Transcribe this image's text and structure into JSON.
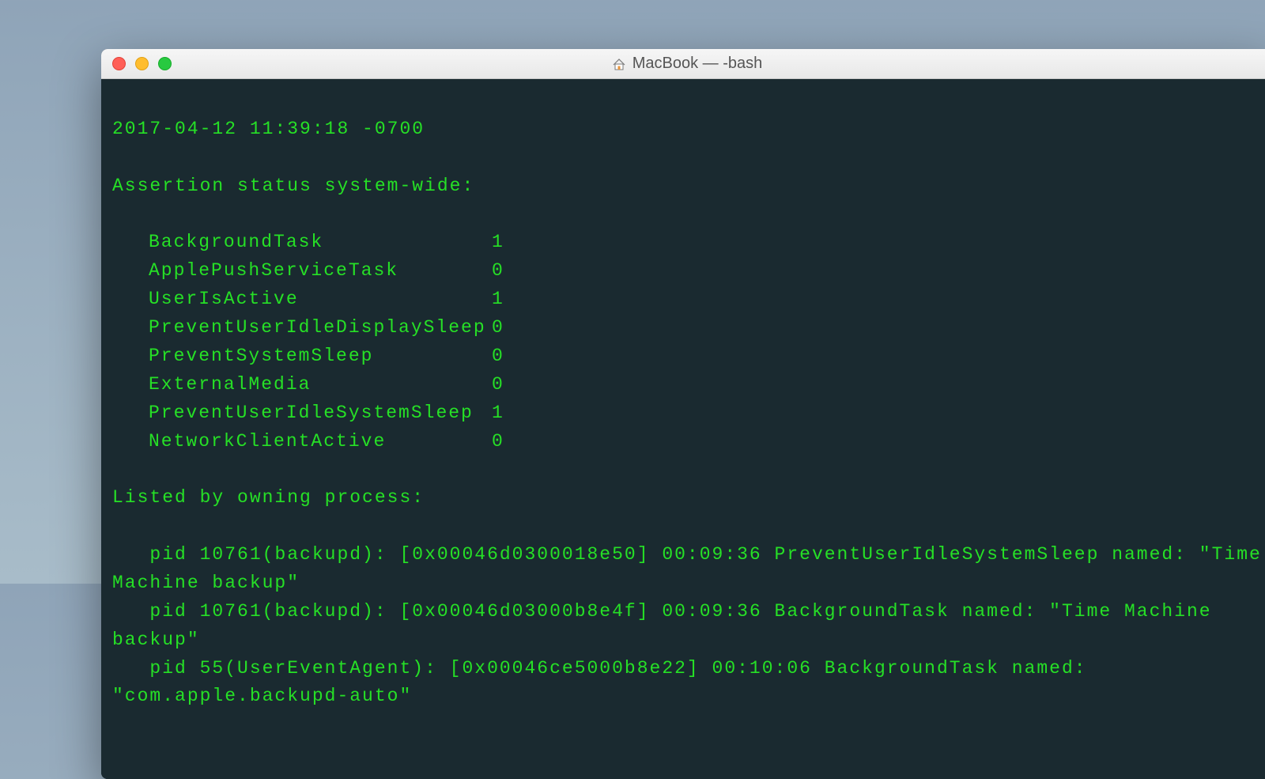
{
  "window": {
    "title": "MacBook — -bash",
    "icon": "home-icon"
  },
  "terminal": {
    "timestamp": "2017-04-12 11:39:18 -0700",
    "assertions_header": "Assertion status system-wide:",
    "assertions": [
      {
        "key": "BackgroundTask",
        "value": "1"
      },
      {
        "key": "ApplePushServiceTask",
        "value": "0"
      },
      {
        "key": "UserIsActive",
        "value": "1"
      },
      {
        "key": "PreventUserIdleDisplaySleep",
        "value": "0"
      },
      {
        "key": "PreventSystemSleep",
        "value": "0"
      },
      {
        "key": "ExternalMedia",
        "value": "0"
      },
      {
        "key": "PreventUserIdleSystemSleep",
        "value": "1"
      },
      {
        "key": "NetworkClientActive",
        "value": "0"
      }
    ],
    "listed_header": "Listed by owning process:",
    "processes": [
      "   pid 10761(backupd): [0x00046d0300018e50] 00:09:36 PreventUserIdleSystemSleep named: \"Time Machine backup\"",
      "   pid 10761(backupd): [0x00046d03000b8e4f] 00:09:36 BackgroundTask named: \"Time Machine backup\"",
      "   pid 55(UserEventAgent): [0x00046ce5000b8e22] 00:10:06 BackgroundTask named: \"com.apple.backupd-auto\""
    ]
  }
}
